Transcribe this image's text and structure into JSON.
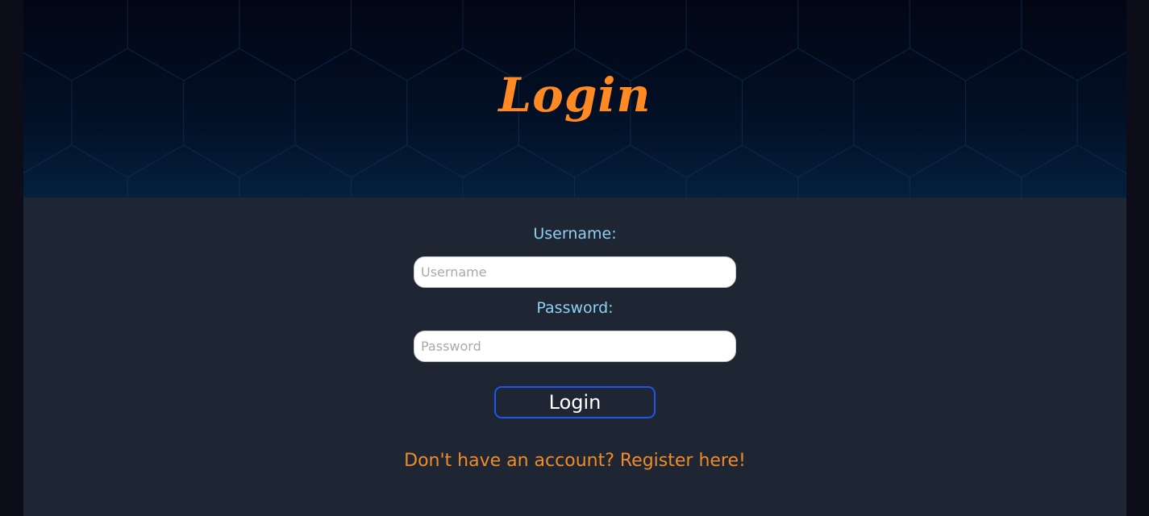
{
  "hero": {
    "title": "Login"
  },
  "form": {
    "username_label": "Username:",
    "username_placeholder": "Username",
    "username_value": "",
    "password_label": "Password:",
    "password_placeholder": "Password",
    "password_value": "",
    "submit_label": "Login"
  },
  "footer": {
    "register_text": "Don't have an account? Register here!"
  },
  "colors": {
    "accent_orange": "#ff8a24",
    "label_blue": "#8ed0f0",
    "button_border": "#1d56e8",
    "panel_bg": "#1f2633"
  }
}
